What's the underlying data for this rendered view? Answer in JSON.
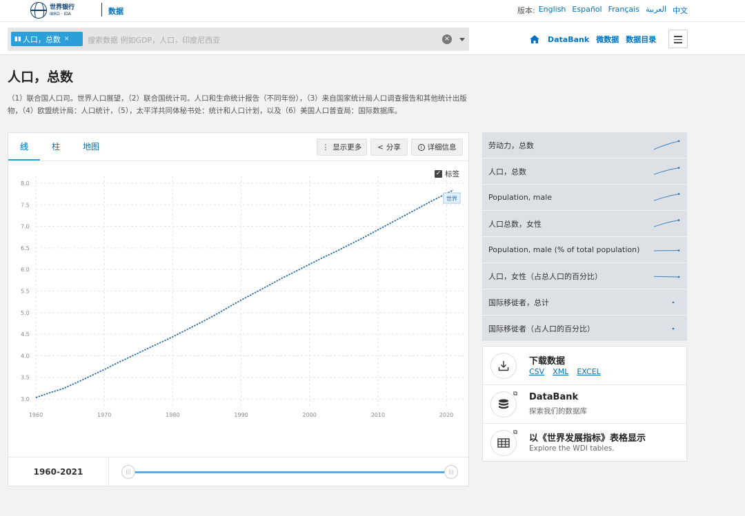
{
  "header": {
    "logo_cn": "世界银行",
    "logo_en": "IBRD · IDA",
    "nav_data": "数据",
    "lang_label": "版本:",
    "languages": [
      "English",
      "Español",
      "Français",
      "العربية",
      "中文"
    ]
  },
  "search": {
    "chip_label": "人口，总数",
    "placeholder": "搜索数据 例如GDP，人口，印度尼西亚"
  },
  "right_nav": {
    "databank": "DataBank",
    "micro": "微数据",
    "catalog": "数据目录"
  },
  "page": {
    "title": "人口，总数",
    "source": "（1）联合国人口司。世界人口展望，（2）联合国统计司。人口和生命统计报告（不同年份），（3）来自国家统计局人口调查报告和其他统计出版物，（4）欧盟统计局：人口统计，（5），太平洋共同体秘书处：统计和人口计划，以及（6）美国人口普查局：国际数据库。"
  },
  "tabs": [
    "线",
    "柱",
    "地图"
  ],
  "toolbar": {
    "show_more": "显示更多",
    "share": "分享",
    "details": "详细信息",
    "label_toggle": "标签"
  },
  "chart_data": {
    "type": "line",
    "series": [
      {
        "name": "世界",
        "x": [
          1960,
          1962,
          1964,
          1966,
          1968,
          1970,
          1972,
          1974,
          1976,
          1978,
          1980,
          1982,
          1984,
          1986,
          1988,
          1990,
          1992,
          1994,
          1996,
          1998,
          2000,
          2002,
          2004,
          2006,
          2008,
          2010,
          2012,
          2014,
          2016,
          2018,
          2020,
          2021
        ],
        "y": [
          3.03,
          3.14,
          3.24,
          3.38,
          3.53,
          3.68,
          3.84,
          3.99,
          4.14,
          4.29,
          4.44,
          4.6,
          4.76,
          4.93,
          5.11,
          5.29,
          5.46,
          5.63,
          5.8,
          5.96,
          6.12,
          6.28,
          6.43,
          6.59,
          6.75,
          6.92,
          7.09,
          7.26,
          7.43,
          7.6,
          7.76,
          7.84
        ]
      }
    ],
    "xticks": [
      1960,
      1970,
      1980,
      1990,
      2000,
      2010,
      2020
    ],
    "yticks": [
      "3.0",
      "3.5",
      "4.0",
      "4.5",
      "5.0",
      "5.5",
      "6.0",
      "6.5",
      "7.0",
      "7.5",
      "8.0"
    ],
    "xlim": [
      1960,
      2021
    ],
    "ylim": [
      3.0,
      8.0
    ],
    "grid": true,
    "color": "#2d6fa8"
  },
  "range": {
    "start": "1960",
    "sep": " - ",
    "end": "2021"
  },
  "indicators": [
    {
      "label": "劳动力，总数",
      "spark": [
        0.2,
        0.5,
        0.75,
        0.95
      ]
    },
    {
      "label": "人口，总数",
      "spark": [
        0.3,
        0.55,
        0.75,
        0.9
      ]
    },
    {
      "label": "Population, male",
      "spark": [
        0.3,
        0.55,
        0.75,
        0.9
      ]
    },
    {
      "label": "人口总数，女性",
      "spark": [
        0.3,
        0.55,
        0.75,
        0.9
      ]
    },
    {
      "label": "Population, male (% of total population)",
      "spark": [
        0.5,
        0.52,
        0.52,
        0.53
      ]
    },
    {
      "label": "人口，女性（占总人口的百分比）",
      "spark": [
        0.55,
        0.53,
        0.52,
        0.5
      ]
    },
    {
      "label": "国际移徙者，总计",
      "spark": []
    },
    {
      "label": "国际移徙者（占人口的百分比）",
      "spark": []
    }
  ],
  "actions": {
    "download_title": "下载数据",
    "download_links": [
      "CSV",
      "XML",
      "EXCEL"
    ],
    "databank_title": "DataBank",
    "databank_sub": "探索我们的数据库",
    "wdi_title": "以《世界发展指标》表格显示",
    "wdi_sub": "Explore the WDI tables."
  },
  "colors": {
    "accent": "#2a9fd8",
    "link": "#0071bc",
    "line": "#2d6fa8"
  }
}
